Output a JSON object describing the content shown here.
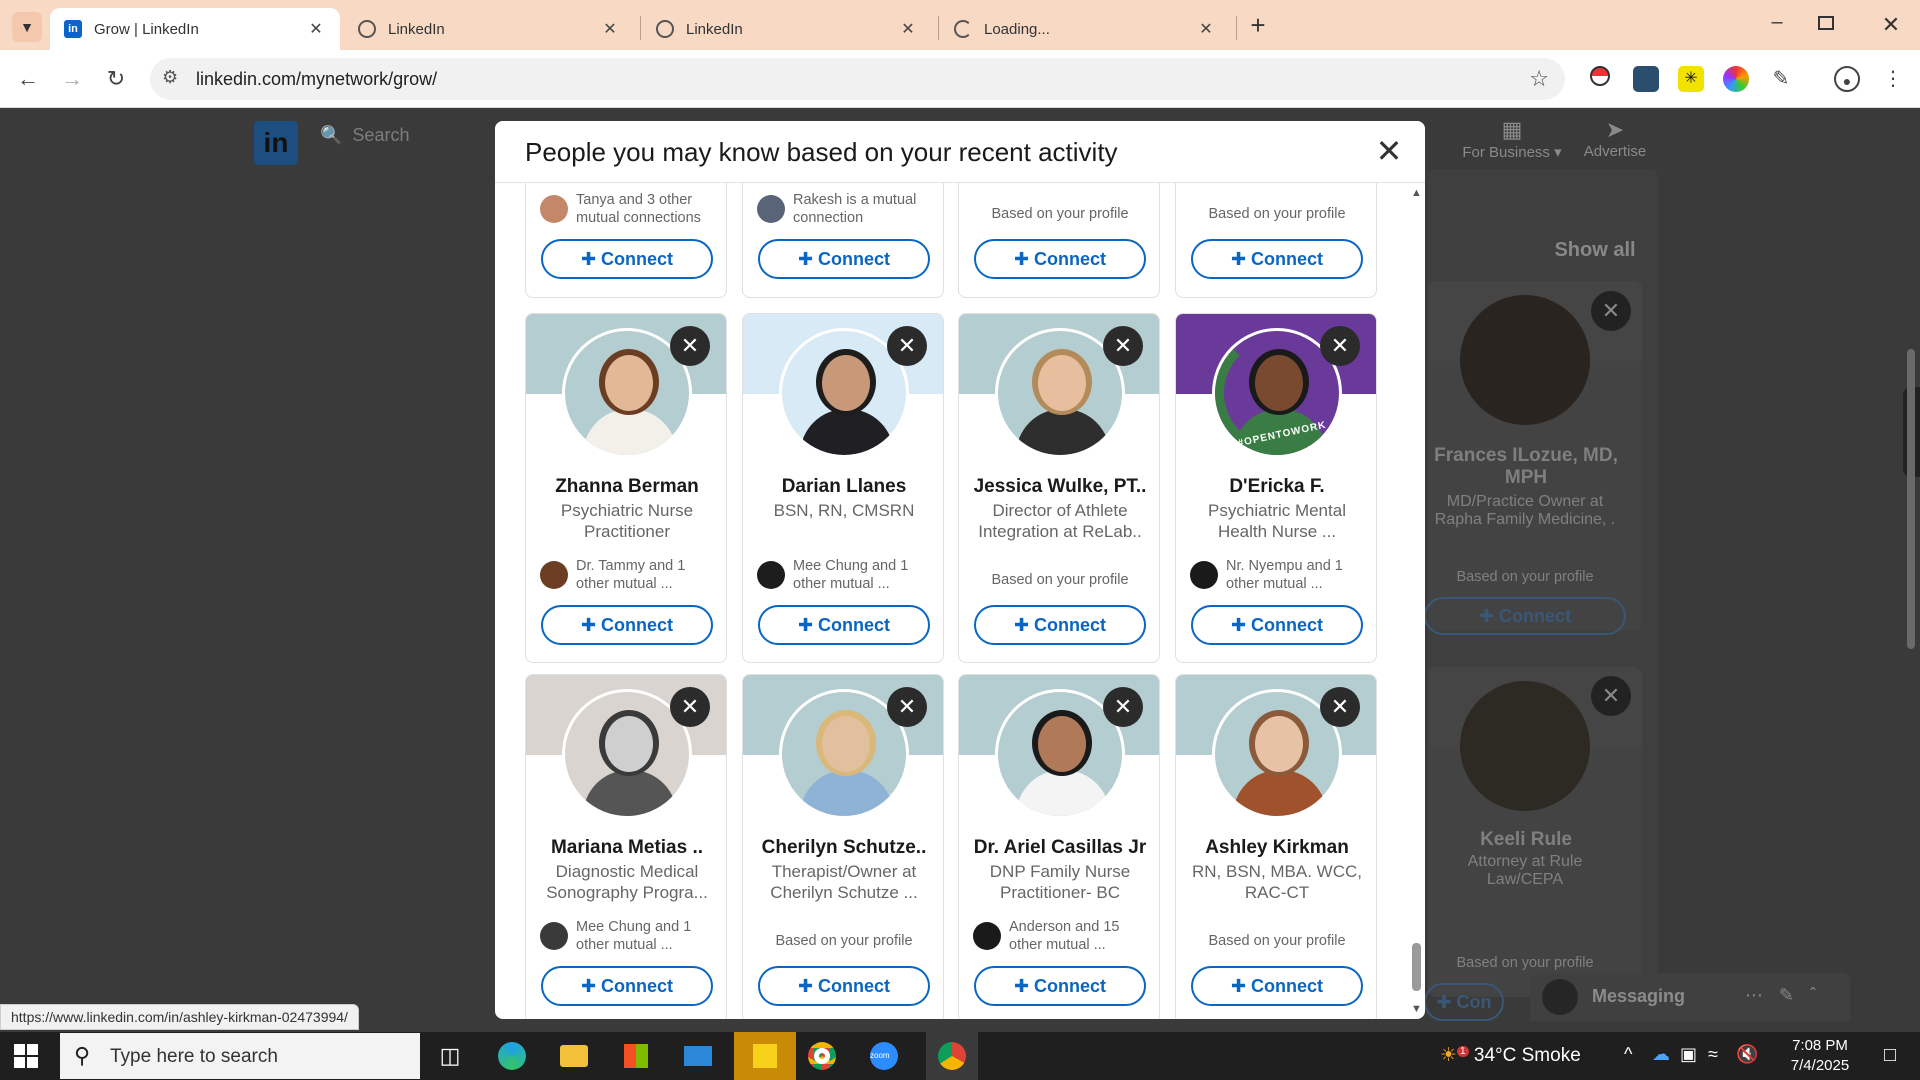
{
  "browser": {
    "tabs": [
      {
        "title": "Grow | LinkedIn",
        "active": true
      },
      {
        "title": "LinkedIn",
        "active": false
      },
      {
        "title": "LinkedIn",
        "active": false
      },
      {
        "title": "Loading...",
        "active": false
      }
    ],
    "url": "linkedin.com/mynetwork/grow/",
    "status_url": "https://www.linkedin.com/in/ashley-kirkman-02473994/"
  },
  "background": {
    "search_placeholder": "Search",
    "for_business": "For Business",
    "advertise": "Advertise",
    "show_all": "Show all",
    "cards": [
      {
        "name": "Frances ILozue, MD, MPH",
        "headline": "MD/Practice Owner at Rapha Family Medicine, .",
        "based": "Based on your profile",
        "connect": "Connect"
      },
      {
        "name": "Keeli Rule",
        "headline": "Attorney at Rule Law/CEPA",
        "based": "Based on your profile",
        "connect": "Con"
      }
    ],
    "messaging": "Messaging"
  },
  "modal": {
    "title": "People you may know based on your recent activity",
    "top_row": [
      {
        "mutual": "Tanya and 3 other mutual connections",
        "based": "",
        "connect": "Connect"
      },
      {
        "mutual": "Rakesh is a mutual connection",
        "based": "",
        "connect": "Connect"
      },
      {
        "mutual": "",
        "based": "Based on your profile",
        "connect": "Connect"
      },
      {
        "mutual": "",
        "based": "Based on your profile",
        "connect": "Connect"
      }
    ],
    "row2": [
      {
        "name": "Zhanna Berman",
        "headline": "Psychiatric Nurse Practitioner",
        "mutual": "Dr. Tammy and 1 other mutual ...",
        "based": "",
        "connect": "Connect",
        "banner": "#b4cdd0",
        "skin": "#e3b896",
        "hair": "#6b3d22",
        "shirt": "#f3f0ea"
      },
      {
        "name": "Darian Llanes",
        "headline": "BSN, RN, CMSRN",
        "mutual": "Mee Chung and 1 other mutual ...",
        "based": "",
        "connect": "Connect",
        "banner": "#d8eaf5",
        "skin": "#c89878",
        "hair": "#1d1d1d",
        "shirt": "#1f1f24"
      },
      {
        "name": "Jessica Wulke, PT..",
        "headline": "Director of Athlete Integration at ReLab..",
        "mutual": "",
        "based": "Based on your profile",
        "connect": "Connect",
        "banner": "#b4cdd0",
        "skin": "#e7bf9f",
        "hair": "#b38a5a",
        "shirt": "#2e2e2e"
      },
      {
        "name": "D'Ericka F.",
        "headline": "Psychiatric Mental Health Nurse ...",
        "mutual": "Nr. Nyempu and 1 other mutual ...",
        "based": "",
        "connect": "Connect",
        "banner": "#6a3a9a",
        "skin": "#7a4a30",
        "hair": "#1a1a1a",
        "shirt": "#3a7d44",
        "badge": "#OPENTOWORK"
      }
    ],
    "row3": [
      {
        "name": "Mariana Metias ..",
        "headline": "Diagnostic Medical Sonography Progra...",
        "mutual": "Mee Chung and 1 other mutual ...",
        "based": "",
        "connect": "Connect",
        "banner": "#d9d4cf",
        "skin": "#cfcfcf",
        "hair": "#3a3a3a",
        "shirt": "#555555"
      },
      {
        "name": "Cherilyn Schutze..",
        "headline": "Therapist/Owner at Cherilyn Schutze ...",
        "mutual": "",
        "based": "Based on your profile",
        "connect": "Connect",
        "banner": "#b4cdd0",
        "skin": "#e2bf9e",
        "hair": "#d9b87a",
        "shirt": "#8fb3d6"
      },
      {
        "name": "Dr. Ariel Casillas Jr",
        "headline": "DNP Family Nurse Practitioner- BC",
        "mutual": "Anderson and 15 other mutual ...",
        "based": "",
        "connect": "Connect",
        "banner": "#b4cdd0",
        "skin": "#b07a58",
        "hair": "#1a1a1a",
        "shirt": "#f4f4f4"
      },
      {
        "name": "Ashley Kirkman",
        "headline": "RN, BSN, MBA. WCC, RAC-CT",
        "mutual": "",
        "based": "Based on your profile",
        "connect": "Connect",
        "banner": "#b4cdd0",
        "skin": "#e7c2a4",
        "hair": "#8a5a3a",
        "shirt": "#a0522d"
      }
    ]
  },
  "taskbar": {
    "search_placeholder": "Type here to search",
    "weather": "34°C  Smoke",
    "weather_badge": "1",
    "time": "7:08 PM",
    "date": "7/4/2025"
  }
}
